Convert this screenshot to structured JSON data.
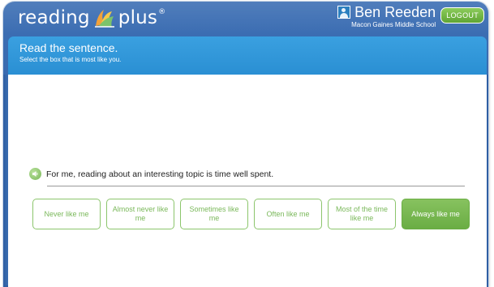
{
  "header": {
    "logo_left": "reading",
    "logo_right": "plus",
    "logo_mark": "®",
    "user_name": "Ben Reeden",
    "school": "Macon Gaines Middle School",
    "logout_label": "LOGOUT"
  },
  "instructions": {
    "title": "Read the sentence.",
    "subtitle": "Select the box that is most like you."
  },
  "question": {
    "sentence": "For me, reading about an interesting topic is time well spent.",
    "audio_icon": "speaker-icon"
  },
  "choices": [
    {
      "label": "Never like me",
      "selected": false
    },
    {
      "label": "Almost never like me",
      "selected": false
    },
    {
      "label": "Sometimes like me",
      "selected": false
    },
    {
      "label": "Often like me",
      "selected": false
    },
    {
      "label": "Most of the time like me",
      "selected": false
    },
    {
      "label": "Always like me",
      "selected": true
    }
  ],
  "colors": {
    "frame_blue": "#2f5fa3",
    "banner_blue": "#2a8fd3",
    "accent_green": "#7ab85a"
  }
}
